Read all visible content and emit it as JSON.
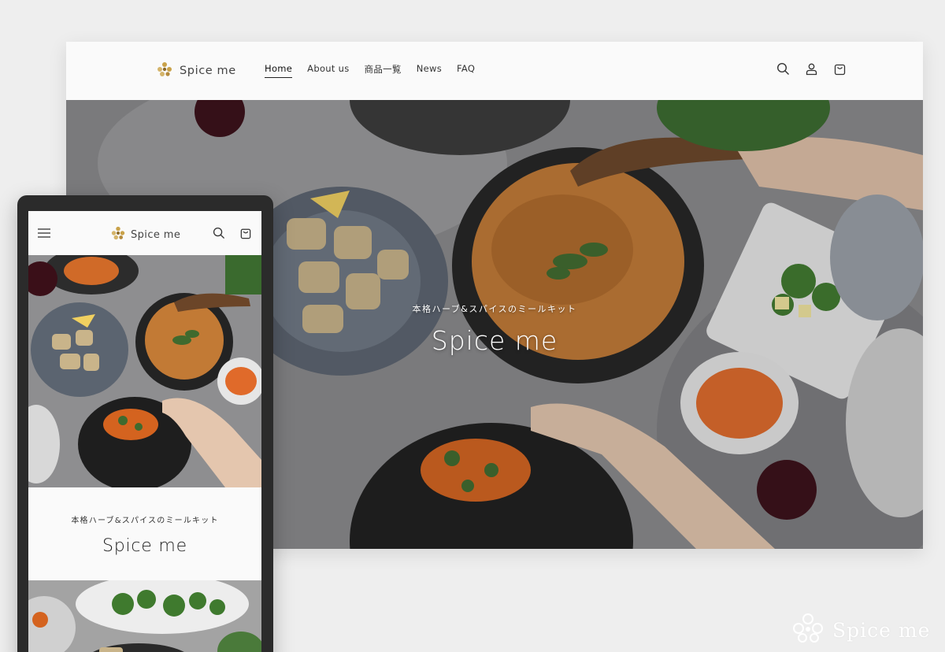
{
  "brand": {
    "name": "Spice me",
    "logo_icon": "spice-flower-logo-icon",
    "accent_color": "#b48a3c"
  },
  "desktop": {
    "nav": [
      {
        "label": "Home",
        "active": true
      },
      {
        "label": "About us",
        "active": false
      },
      {
        "label": "商品一覧",
        "active": false
      },
      {
        "label": "News",
        "active": false
      },
      {
        "label": "FAQ",
        "active": false
      }
    ],
    "icons": [
      "search-icon",
      "account-icon",
      "cart-icon"
    ],
    "hero": {
      "subtitle": "本格ハーブ&スパイスのミールキット",
      "title": "Spice me"
    }
  },
  "mobile": {
    "icons": [
      "menu-icon",
      "search-icon",
      "cart-icon"
    ],
    "subtitle": "本格ハーブ&スパイスのミールキット",
    "title": "Spice me"
  },
  "watermark": {
    "text": "Spice me"
  }
}
